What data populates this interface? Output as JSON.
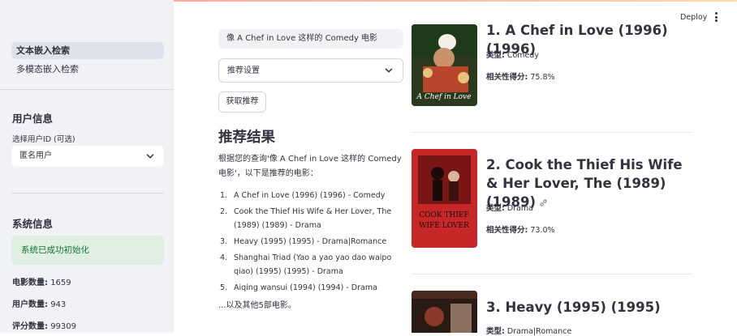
{
  "sidebar": {
    "nav": [
      "文本嵌入检索",
      "多模态嵌入检索"
    ],
    "user_section_title": "用户信息",
    "user_select_label": "选择用户ID (可选)",
    "user_select_value": "匿名用户",
    "system_section_title": "系统信息",
    "system_alert": "系统已成功初始化",
    "stats": [
      {
        "label": "电影数量:",
        "value": "1659"
      },
      {
        "label": "用户数量:",
        "value": "943"
      },
      {
        "label": "评分数量:",
        "value": "99309"
      }
    ]
  },
  "header": {
    "deploy_label": "Deploy",
    "menu_icon": "kebab-menu-icon"
  },
  "main": {
    "query_value": "像 A Chef in Love 这样的 Comedy 电影",
    "settings_label": "推荐设置",
    "submit_label": "获取推荐",
    "results_title": "推荐结果",
    "summary": "根据您的查询'像 A Chef in Love 这样的 Comedy 电影'，以下是推荐的电影：",
    "list": [
      "A Chef in Love (1996) (1996) - Comedy",
      "Cook the Thief His Wife & Her Lover, The (1989) (1989) - Drama",
      "Heavy (1995) (1995) - Drama|Romance",
      "Shanghai Triad (Yao a yao yao dao waipo qiao) (1995) (1995) - Drama",
      "Aiqing wansui (1994) (1994) - Drama"
    ],
    "tail": "...以及其他5部电影。"
  },
  "results": [
    {
      "title": "1. A Chef in Love (1996) (1996)",
      "genre_label": "类型:",
      "genre": "Comedy",
      "score_label": "相关性得分:",
      "score": "75.8%",
      "poster_colors": [
        "#1f3a1a",
        "#b8462d",
        "#e7c27a"
      ]
    },
    {
      "title": "2. Cook the Thief His Wife & Her Lover, The (1989) (1989)",
      "genre_label": "类型:",
      "genre": "Drama",
      "score_label": "相关性得分:",
      "score": "73.0%",
      "poster_colors": [
        "#7a1515",
        "#c62828",
        "#1a0a0a"
      ]
    },
    {
      "title": "3. Heavy (1995) (1995)",
      "genre_label": "类型:",
      "genre": "Drama|Romance",
      "poster_colors": [
        "#2a1a14",
        "#8b3a2a",
        "#d9b89a"
      ]
    }
  ]
}
